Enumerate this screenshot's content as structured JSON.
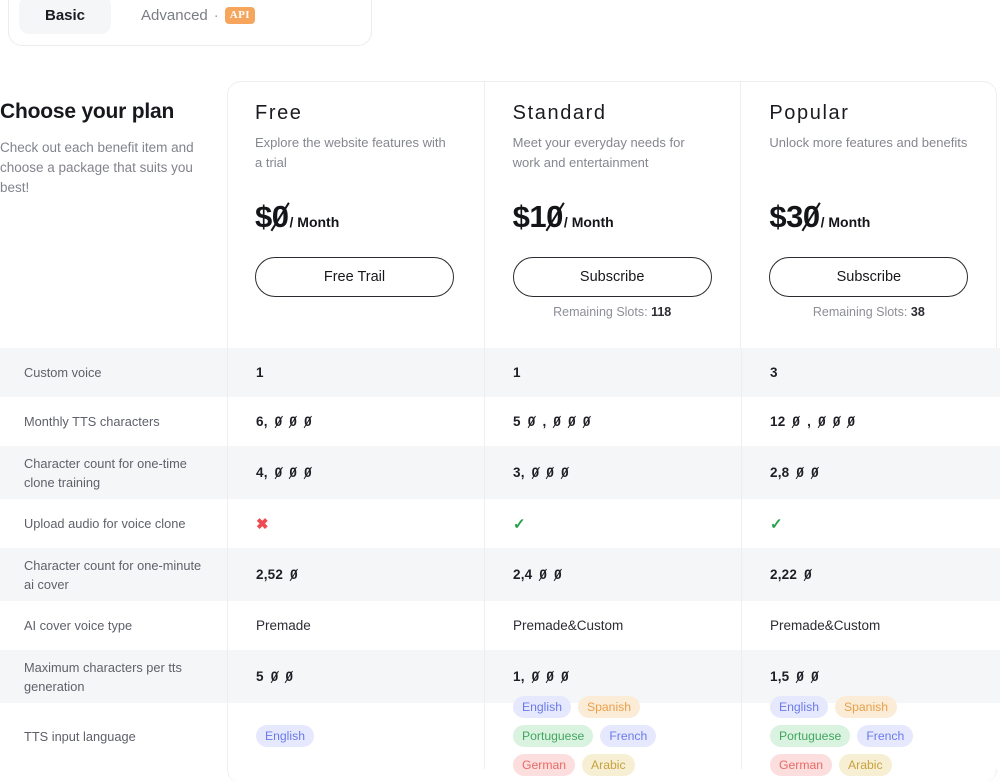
{
  "tabs": [
    {
      "label": "Basic",
      "active": true,
      "badge": null
    },
    {
      "label": "Advanced",
      "active": false,
      "separator": "·",
      "badge": "API"
    }
  ],
  "intro": {
    "title": "Choose your plan",
    "subtitle": "Check out each benefit item and choose a package that suits you best!"
  },
  "plans": [
    {
      "name": "Free",
      "description": "Explore the website features with a trial",
      "currency": "$",
      "price": "0",
      "unit": "/ Month",
      "cta": "Free Trail",
      "slots_label": null,
      "slots_value": null
    },
    {
      "name": "Standard",
      "description": "Meet your everyday needs for work and entertainment",
      "currency": "$",
      "price": "10",
      "unit": "/ Month",
      "cta": "Subscribe",
      "slots_label": "Remaining Slots:",
      "slots_value": "118"
    },
    {
      "name": "Popular",
      "description": "Unlock more features and benefits",
      "currency": "$",
      "price": "30",
      "unit": "/ Month",
      "cta": "Subscribe",
      "slots_label": "Remaining Slots:",
      "slots_value": "38"
    }
  ],
  "features": [
    {
      "label": "Custom voice",
      "type": "text",
      "values": [
        "1",
        "1",
        "3"
      ]
    },
    {
      "label": "Monthly TTS characters",
      "type": "text",
      "values": [
        "6,000",
        "50,000",
        "120,000"
      ]
    },
    {
      "label": "Character count for one-time clone training",
      "type": "text",
      "values": [
        "4,000",
        "3,000",
        "2,800"
      ]
    },
    {
      "label": "Upload audio for voice clone",
      "type": "mark",
      "values": [
        "x",
        "v",
        "v"
      ]
    },
    {
      "label": "Character count for one-minute ai cover",
      "type": "text",
      "values": [
        "2,520",
        "2,400",
        "2,220"
      ]
    },
    {
      "label": "AI cover voice type",
      "type": "plaintext",
      "values": [
        "Premade",
        "Premade&Custom",
        "Premade&Custom"
      ]
    },
    {
      "label": "Maximum characters per tts generation",
      "type": "text",
      "values": [
        "500",
        "1,000",
        "1,500"
      ]
    },
    {
      "label": "TTS input language",
      "type": "tags",
      "values": [
        [
          "English"
        ],
        [
          "English",
          "Spanish",
          "Portuguese",
          "French",
          "German",
          "Arabic"
        ],
        [
          "English",
          "Spanish",
          "Portuguese",
          "French",
          "German",
          "Arabic"
        ]
      ]
    }
  ],
  "marks": {
    "x": "✖",
    "v": "✓"
  },
  "colors": {
    "row_alt_bg": "#f5f6f8",
    "row_bg": "#ffffff",
    "border": "#eeeef1",
    "text_primary": "#1a1b20",
    "text_muted": "#82848c",
    "mark_x": "#ef4a52",
    "mark_v": "#24a148",
    "api_badge": "#f5a55c",
    "tag_english_bg": "#e6e9fd",
    "tag_english_fg": "#6b7ae8",
    "tag_spanish_bg": "#fbecd8",
    "tag_spanish_fg": "#e8a14a",
    "tag_portuguese_bg": "#daf2e0",
    "tag_portuguese_fg": "#41a65e",
    "tag_german_bg": "#fbdedd",
    "tag_german_fg": "#e86b67",
    "tag_arabic_bg": "#f7efd3",
    "tag_arabic_fg": "#c7a23e"
  }
}
